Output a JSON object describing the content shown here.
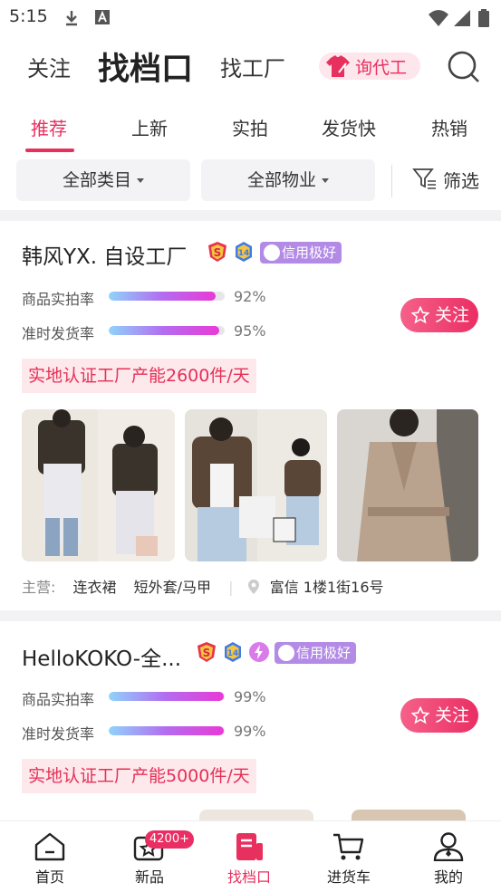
{
  "status_bar": {
    "time": "5:15"
  },
  "top_nav": {
    "follow": "关注",
    "find_stall": "找档口",
    "find_factory": "找工厂",
    "inquiry": "询代工"
  },
  "tabs": [
    {
      "label": "推荐",
      "active": true
    },
    {
      "label": "上新"
    },
    {
      "label": "实拍"
    },
    {
      "label": "发货快"
    },
    {
      "label": "热销"
    }
  ],
  "filters": {
    "category": "全部类目",
    "property": "全部物业",
    "filter": "筛选"
  },
  "shops": [
    {
      "name": "韩风YX. 自设工厂",
      "credit": "信用极好",
      "metrics": [
        {
          "label": "商品实拍率",
          "value": "92%",
          "ratio": 0.92
        },
        {
          "label": "准时发货率",
          "value": "95%",
          "ratio": 0.95
        }
      ],
      "follow": "关注",
      "certification": "实地认证工厂产能2600件/天",
      "main_business_label": "主营:",
      "categories": [
        "连衣裙",
        "短外套/马甲"
      ],
      "location": "富信 1楼1街16号"
    },
    {
      "name": "HelloKOKO-全...",
      "credit": "信用极好",
      "metrics": [
        {
          "label": "商品实拍率",
          "value": "99%",
          "ratio": 0.99
        },
        {
          "label": "准时发货率",
          "value": "99%",
          "ratio": 0.99
        }
      ],
      "follow": "关注",
      "certification": "实地认证工厂产能5000件/天"
    }
  ],
  "bottom_nav": [
    {
      "label": "首页",
      "icon": "home-icon"
    },
    {
      "label": "新品",
      "icon": "star-box-icon",
      "badge": "4200+"
    },
    {
      "label": "找档口",
      "icon": "stall-icon",
      "active": true
    },
    {
      "label": "进货车",
      "icon": "cart-icon"
    },
    {
      "label": "我的",
      "icon": "user-icon"
    }
  ],
  "colors": {
    "accent": "#e8305f",
    "credit": "#b38be6"
  }
}
